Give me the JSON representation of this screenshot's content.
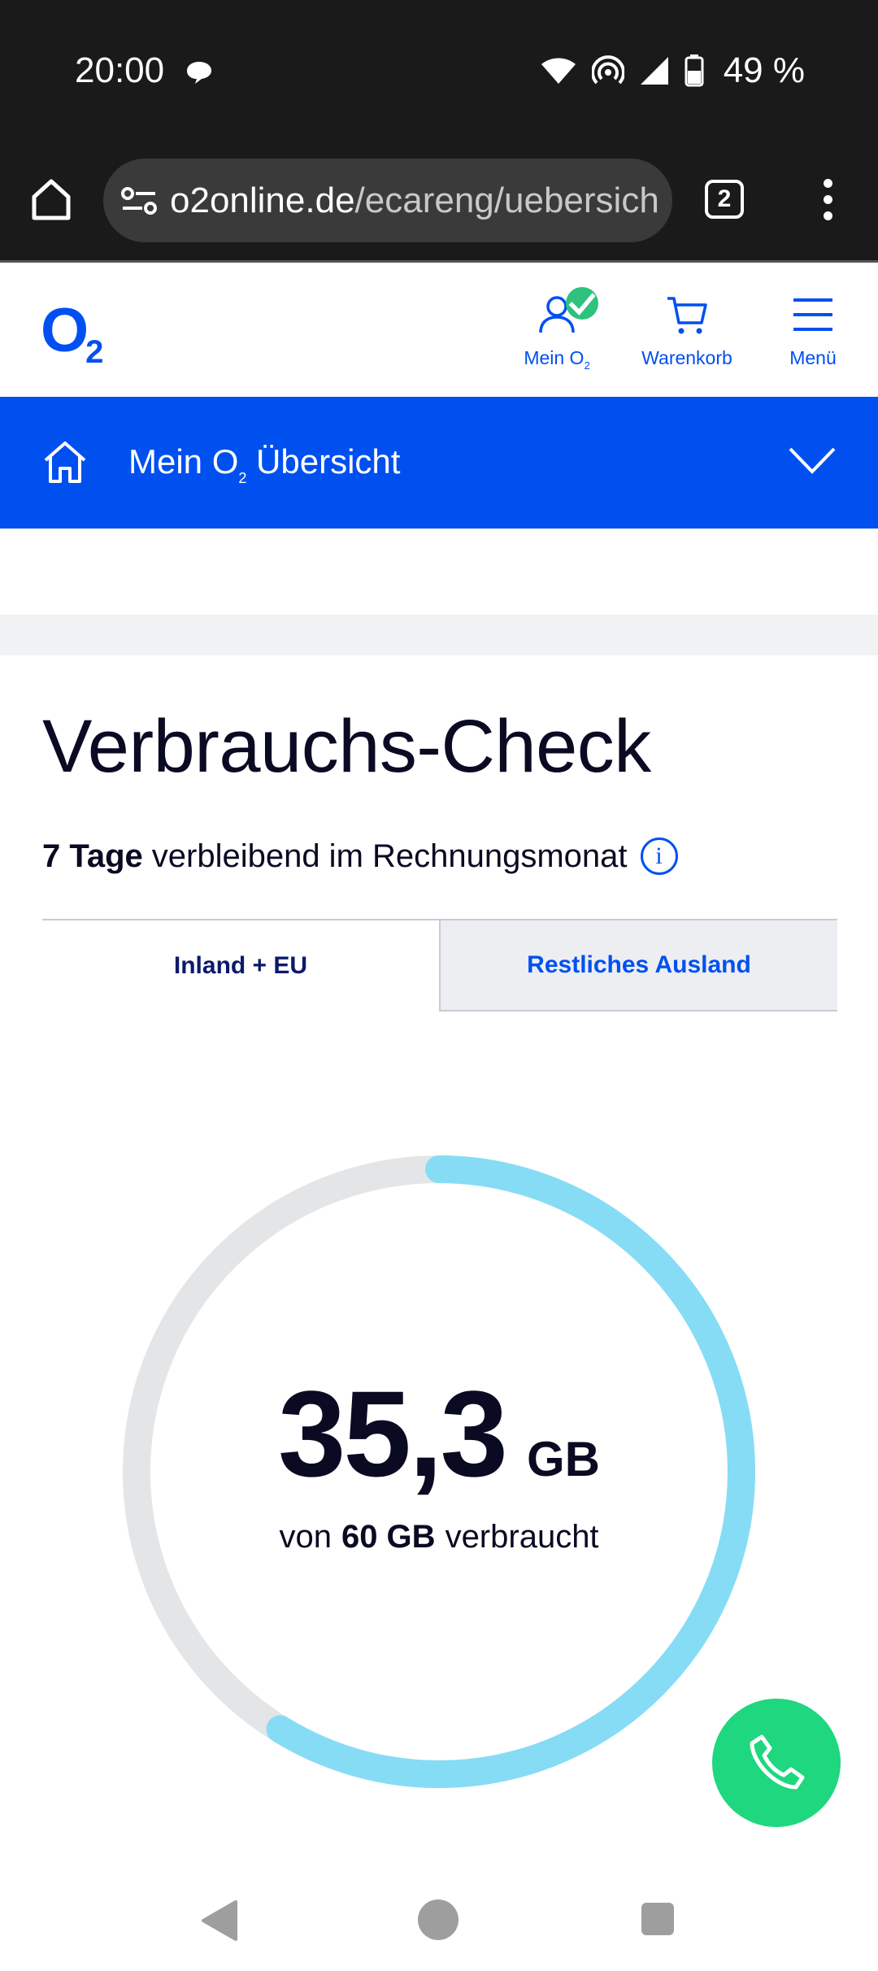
{
  "status_bar": {
    "time": "20:00",
    "battery": "49 %"
  },
  "browser": {
    "url_host": "o2online.de",
    "url_path": "/ecareng/uebersich",
    "tab_count": "2"
  },
  "header": {
    "logo_main": "O",
    "logo_sub": "2",
    "mein_o2_label": "Mein O",
    "mein_o2_sub": "2",
    "cart_label": "Warenkorb",
    "menu_label": "Menü"
  },
  "nav": {
    "title_prefix": "Mein O",
    "title_sub": "2",
    "title_suffix": " Übersicht"
  },
  "main": {
    "title": "Verbrauchs-Check",
    "remaining_days": "7 Tage",
    "remaining_text": "verbleibend im Rechnungsmonat",
    "info_icon": "i",
    "tabs": [
      {
        "label": "Inland + EU",
        "active": true
      },
      {
        "label": "Restliches Ausland",
        "active": false
      }
    ]
  },
  "usage": {
    "used_value": "35,3",
    "used_unit": "GB",
    "caption_prefix": "von",
    "total": "60 GB",
    "caption_suffix": "verbraucht",
    "used_fraction": 0.588
  },
  "colors": {
    "brand_blue": "#0050f0",
    "gauge_fill": "#86dcf5",
    "gauge_track": "#e4e5e7",
    "call_green": "#1ed77f",
    "check_green": "#2ec27e"
  },
  "icons": {
    "home": "home-icon",
    "account": "user-icon",
    "cart": "cart-icon",
    "menu": "hamburger-icon",
    "call": "phone-icon"
  }
}
